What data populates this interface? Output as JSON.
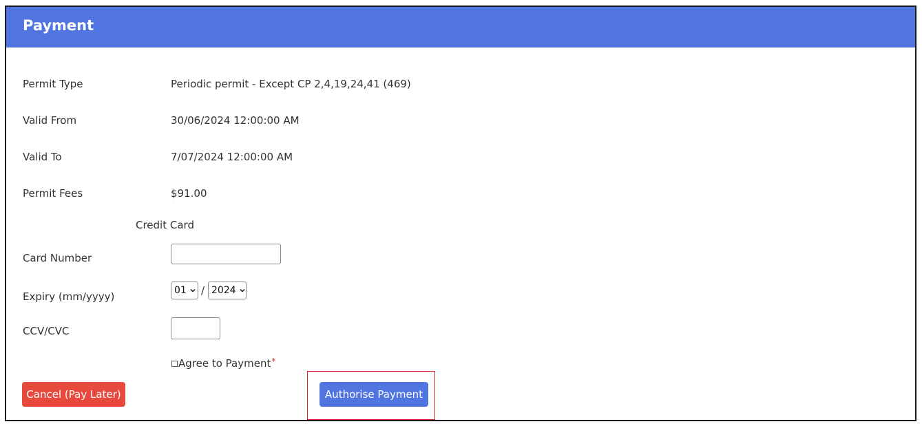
{
  "header": {
    "title": "Payment"
  },
  "details": [
    {
      "label": "Permit Type",
      "value": "Periodic permit - Except CP 2,4,19,24,41 (469)"
    },
    {
      "label": "Valid From",
      "value": "30/06/2024 12:00:00 AM"
    },
    {
      "label": "Valid To",
      "value": "7/07/2024 12:00:00 AM"
    },
    {
      "label": "Permit Fees",
      "value": "$91.00"
    }
  ],
  "credit_card": {
    "section_label": "Credit Card",
    "card_number_label": "Card Number",
    "card_number_value": "",
    "expiry_label": "Expiry (mm/yyyy)",
    "expiry_month": "01",
    "expiry_separator": "/",
    "expiry_year": "2024",
    "ccv_label": "CCV/CVC",
    "ccv_value": ""
  },
  "agreement": {
    "label": "Agree to Payment",
    "required_marker": "*",
    "checked": false
  },
  "actions": {
    "cancel_label": "Cancel (Pay Later)",
    "authorise_label": "Authorise Payment"
  },
  "colors": {
    "header": "#5074e0",
    "primary_button": "#5074e0",
    "danger_button": "#e8493d",
    "highlight_box": "#e0202e"
  }
}
